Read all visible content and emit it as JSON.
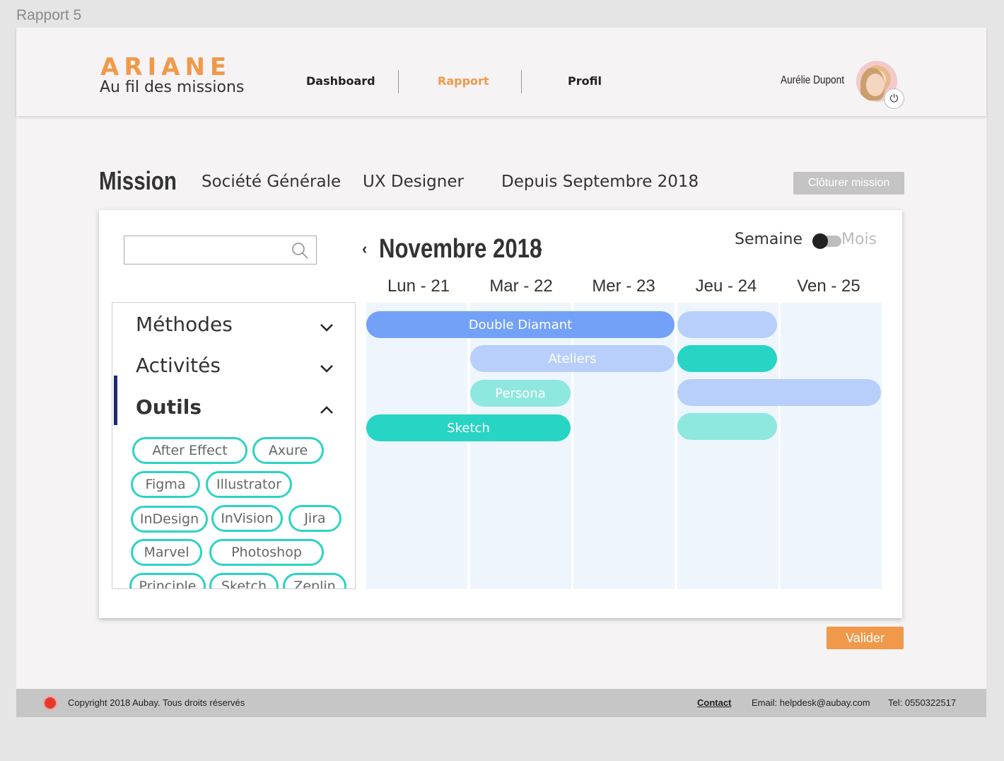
{
  "frame_title": "Rapport 5",
  "header": {
    "logo_title": "ARIANE",
    "logo_subtitle": "Au fil des missions",
    "nav": [
      {
        "label": "Dashboard",
        "active": false
      },
      {
        "label": "Rapport",
        "active": true
      },
      {
        "label": "Profil",
        "active": false
      }
    ],
    "user_name": "Aurélie Dupont"
  },
  "mission": {
    "label": "Mission",
    "company": "Société Générale",
    "role": "UX Designer",
    "since": "Depuis Septembre 2018",
    "close_button": "Clôturer mission"
  },
  "calendar": {
    "month": "Novembre 2018",
    "prev_icon": "‹",
    "next_icon": "›",
    "view_toggle": {
      "left": "Semaine",
      "right": "Mois",
      "selected": "Semaine"
    },
    "days": [
      "Lun - 21",
      "Mar - 22",
      "Mer - 23",
      "Jeu - 24",
      "Ven - 25"
    ],
    "events": [
      {
        "label": "Double Diamant",
        "color": "#72a1f7"
      },
      {
        "label": "",
        "color": "#b7cffa"
      },
      {
        "label": "Ateliers",
        "color": "#b7cffa"
      },
      {
        "label": "",
        "color": "#28d4c4"
      },
      {
        "label": "Persona",
        "color": "#8ee8df"
      },
      {
        "label": "",
        "color": "#b7cffa"
      },
      {
        "label": "Sketch",
        "color": "#28d4c4"
      },
      {
        "label": "",
        "color": "#8ee8df"
      }
    ]
  },
  "filters": {
    "sections": [
      {
        "label": "Méthodes",
        "expanded": false
      },
      {
        "label": "Activités",
        "expanded": false
      },
      {
        "label": "Outils",
        "expanded": true
      }
    ],
    "tools": [
      "After Effect",
      "Axure",
      "Figma",
      "Illustrator",
      "InDesign",
      "InVision",
      "Jira",
      "Marvel",
      "Photoshop",
      "Principle",
      "Sketch",
      "Zeplin"
    ],
    "tag_color": "#2cd3c2"
  },
  "validate_button": "Valider",
  "footer": {
    "copyright": "Copyright 2018 Aubay. Tous droits réservés",
    "contact": "Contact",
    "email": "Email: helpdesk@aubay.com",
    "tel": "Tel: 0550322517"
  },
  "colors": {
    "accent": "#f0994a",
    "accent_dark": "#1e2a6e",
    "teal": "#28d4c4"
  }
}
